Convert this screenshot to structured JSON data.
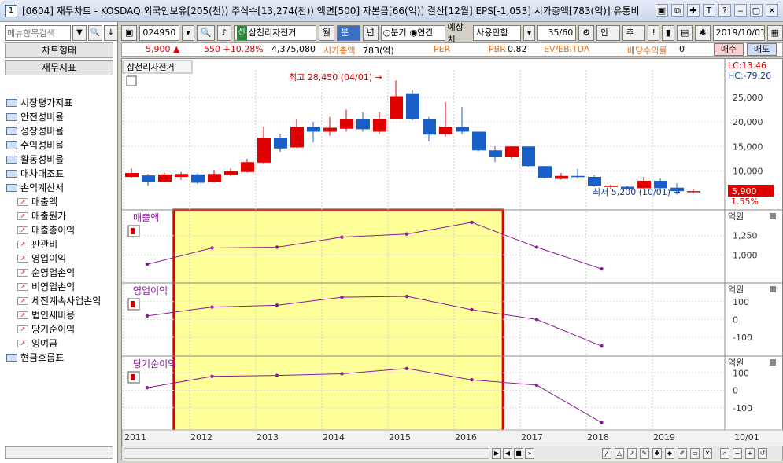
{
  "title": {
    "num": "1",
    "text": "[0604] 재무차트 - KOSDAQ 외국인보유[205(천)) 주식수[13,274(천)) 액면[500] 자본금[66(억)] 결산[12월] EPS[-1,053] 시가총액[783(억)] 유통비"
  },
  "title_buttons": [
    "▣",
    "⧉",
    "✚",
    "T",
    "?",
    "‒",
    "▢",
    "✕"
  ],
  "left": {
    "search_placeholder": "메뉴항목검색",
    "btn_chart": "차트형태",
    "btn_fin": "재무지표",
    "tree": [
      {
        "label": "시장평가지표",
        "level": 0
      },
      {
        "label": "안전성비율",
        "level": 0
      },
      {
        "label": "성장성비율",
        "level": 0
      },
      {
        "label": "수익성비율",
        "level": 0
      },
      {
        "label": "활동성비율",
        "level": 0
      },
      {
        "label": "대차대조표",
        "level": 0
      },
      {
        "label": "손익계산서",
        "level": 0
      },
      {
        "label": "매출액",
        "level": 1
      },
      {
        "label": "매출원가",
        "level": 1
      },
      {
        "label": "매출총이익",
        "level": 1
      },
      {
        "label": "판관비",
        "level": 1
      },
      {
        "label": "영업이익",
        "level": 1
      },
      {
        "label": "순영업손익",
        "level": 1
      },
      {
        "label": "비영업손익",
        "level": 1
      },
      {
        "label": "세전계속사업손익",
        "level": 1
      },
      {
        "label": "법인세비용",
        "level": 1
      },
      {
        "label": "당기순이익",
        "level": 1
      },
      {
        "label": "잉여금",
        "level": 1
      },
      {
        "label": "현금흐름표",
        "level": 0
      }
    ]
  },
  "toolbar": {
    "code": "024950",
    "badge": "신",
    "name": "삼천리자전거",
    "period_week": "월",
    "period_quarter": "분기",
    "period_year": "년",
    "radio_quarter": "○분기",
    "radio_annual": "◉연간",
    "forecast_label": "예상치",
    "forecast_value": "사용안함",
    "count": "35",
    "count_total": "/60",
    "guide": "안내",
    "trend": "추이",
    "excl": "!",
    "date": "2019/10/01"
  },
  "info": {
    "price": "5,900 ▲",
    "change": "550 +10.28%",
    "volume": "4,375,080",
    "mcap_label": "시가총액",
    "mcap_value": "783(억)",
    "per_label": "PER",
    "pbr_label": "PBR",
    "pbr_value": "0.82",
    "ev_label": "EV/EBITDA",
    "div_label": "배당수익률",
    "div_value": "0",
    "buy": "매수",
    "sell": "매도"
  },
  "chart": {
    "stock_label": "삼천리자전거",
    "lc": "LC:13.46",
    "hc": "HC:-79.26",
    "high_annot": "최고 28,450 (04/01) →",
    "low_annot": "최저 5,200 (10/01) →",
    "last_price": "5,900",
    "last_pct": "1.55%",
    "price_ticks": [
      "25,000",
      "20,000",
      "15,000",
      "10,000"
    ],
    "panels": [
      {
        "name": "매출액",
        "unit": "억원",
        "ticks": [
          "1,250",
          "1,000"
        ]
      },
      {
        "name": "영업이익",
        "unit": "억원",
        "ticks": [
          "100",
          "0",
          "-100"
        ]
      },
      {
        "name": "당기순이익",
        "unit": "억원",
        "ticks": [
          "100",
          "0",
          "-100"
        ]
      }
    ],
    "years": [
      "2011",
      "2012",
      "2013",
      "2014",
      "2015",
      "2016",
      "2017",
      "2018",
      "2019"
    ],
    "date_end": "10/01",
    "colors": {
      "up": "#e00000",
      "down": "#1a5ec8",
      "line": "#8a1a9a",
      "highlight_fill": "#ffff99",
      "highlight_border": "#e00000"
    }
  },
  "chart_data": {
    "type": "candlestick+line",
    "price_candles": [
      {
        "o": 8800,
        "c": 9600,
        "h": 10500,
        "l": 8600
      },
      {
        "o": 9100,
        "c": 7700,
        "h": 9400,
        "l": 7000
      },
      {
        "o": 7800,
        "c": 9300,
        "h": 9700,
        "l": 7700
      },
      {
        "o": 8800,
        "c": 9400,
        "h": 9800,
        "l": 8200
      },
      {
        "o": 9300,
        "c": 7600,
        "h": 9500,
        "l": 7300
      },
      {
        "o": 7700,
        "c": 9400,
        "h": 10200,
        "l": 7600
      },
      {
        "o": 9200,
        "c": 10000,
        "h": 10500,
        "l": 9000
      },
      {
        "o": 9800,
        "c": 11800,
        "h": 12500,
        "l": 9700
      },
      {
        "o": 11700,
        "c": 16800,
        "h": 19000,
        "l": 11500
      },
      {
        "o": 16800,
        "c": 14600,
        "h": 17500,
        "l": 13800
      },
      {
        "o": 14800,
        "c": 19000,
        "h": 20500,
        "l": 14700
      },
      {
        "o": 19000,
        "c": 18000,
        "h": 20000,
        "l": 15800
      },
      {
        "o": 18000,
        "c": 18800,
        "h": 21000,
        "l": 17200
      },
      {
        "o": 18600,
        "c": 20500,
        "h": 22500,
        "l": 18000
      },
      {
        "o": 20500,
        "c": 18500,
        "h": 22000,
        "l": 18000
      },
      {
        "o": 18000,
        "c": 20600,
        "h": 22000,
        "l": 17500
      },
      {
        "o": 20500,
        "c": 25200,
        "h": 28450,
        "l": 20500
      },
      {
        "o": 25800,
        "c": 20500,
        "h": 26500,
        "l": 20300
      },
      {
        "o": 20500,
        "c": 17400,
        "h": 21000,
        "l": 16000
      },
      {
        "o": 17500,
        "c": 19000,
        "h": 24000,
        "l": 17000
      },
      {
        "o": 19000,
        "c": 18000,
        "h": 23000,
        "l": 17500
      },
      {
        "o": 18000,
        "c": 14200,
        "h": 18000,
        "l": 14000
      },
      {
        "o": 14200,
        "c": 12800,
        "h": 15000,
        "l": 11800
      },
      {
        "o": 12800,
        "c": 15000,
        "h": 15000,
        "l": 12500
      },
      {
        "o": 15000,
        "c": 11000,
        "h": 15000,
        "l": 10800
      },
      {
        "o": 11000,
        "c": 8600,
        "h": 11000,
        "l": 8500
      },
      {
        "o": 8400,
        "c": 9000,
        "h": 9600,
        "l": 8200
      },
      {
        "o": 9000,
        "c": 8800,
        "h": 10400,
        "l": 8500
      },
      {
        "o": 8800,
        "c": 7000,
        "h": 9200,
        "l": 6800
      },
      {
        "o": 6800,
        "c": 7000,
        "h": 7200,
        "l": 6300
      },
      {
        "o": 6800,
        "c": 6400,
        "h": 7000,
        "l": 6200
      },
      {
        "o": 6500,
        "c": 8000,
        "h": 8800,
        "l": 6400
      },
      {
        "o": 8000,
        "c": 6500,
        "h": 8500,
        "l": 6000
      },
      {
        "o": 6600,
        "c": 5900,
        "h": 7500,
        "l": 5200
      },
      {
        "o": 5900,
        "c": 5900,
        "h": 6400,
        "l": 5500
      }
    ],
    "sales": {
      "x": [
        2011,
        2012,
        2013,
        2014,
        2015,
        2016,
        2017,
        2018
      ],
      "values": [
        880,
        1090,
        1100,
        1230,
        1270,
        1420,
        1100,
        820
      ]
    },
    "operating_income": {
      "x": [
        2011,
        2012,
        2013,
        2014,
        2015,
        2016,
        2017,
        2018
      ],
      "values": [
        20,
        70,
        80,
        125,
        130,
        55,
        0,
        -150
      ]
    },
    "net_income": {
      "x": [
        2011,
        2012,
        2013,
        2014,
        2015,
        2016,
        2017,
        2018
      ],
      "values": [
        15,
        80,
        85,
        95,
        125,
        60,
        30,
        -185
      ]
    },
    "highlight_years": [
      2012,
      2016
    ]
  }
}
